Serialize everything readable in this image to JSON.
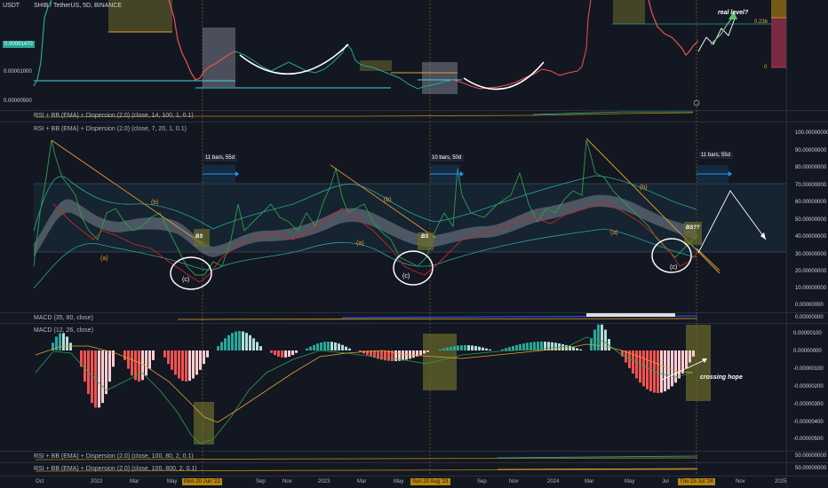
{
  "header": {
    "currency": "USDT",
    "title": "SHIB / TetherUS, 5D, BINANCE",
    "title_color": "#b2b5be"
  },
  "price_pane": {
    "current_price_badge": "0.00001470",
    "badge_color": "#26a69a",
    "y_ticks": [
      "0.00001000",
      "0.00000500"
    ],
    "annotations": {
      "real_level": "real level?",
      "fib_level": "0.236",
      "zero_level": "0"
    }
  },
  "indicators": {
    "rsi_small_top": "RSI + BB (EMA) + Dispersion (2.0) (close, 14, 100, 1, 0.1)",
    "rsi_main": "RSI + BB (EMA) + Dispersion (2.0) (close, 7, 20, 1, 0.1)",
    "macd_small": "MACD (35, 80, close)",
    "macd_main": "MACD (12, 26, close)",
    "rsi_bottom_1": "RSI + BB (EMA) + Dispersion (2.0) (close, 100, 80, 2, 0.1)",
    "rsi_bottom_2": "RSI + BB (EMA) + Dispersion (2.0) (close, 100, 800, 2, 0.1)"
  },
  "rsi_pane": {
    "y_ticks": [
      "100.00000000",
      "90.00000000",
      "80.00000000",
      "70.00000000",
      "60.00000000",
      "50.00000000",
      "40.00000000",
      "30.00000000",
      "20.00000000",
      "10.00000000",
      "0.00000000"
    ],
    "bar_labels": [
      "11 bars, 55d",
      "10 bars, 50d",
      "11 bars, 55d"
    ],
    "waves": {
      "a": "(a)",
      "b": "(b)",
      "c": "(c)"
    },
    "bs_labels": [
      "BS",
      "BS",
      "BS??"
    ]
  },
  "macd_small_pane": {
    "y_tick": "0.00000000"
  },
  "macd_pane": {
    "y_ticks": [
      "0.00000100",
      "0.00000000",
      "-0.00000100",
      "-0.00000200",
      "-0.00000300",
      "-0.00000400",
      "-0.00000500"
    ],
    "annotation": "crossing hope"
  },
  "bottom_panes": {
    "y_tick_1": "50.00000000",
    "y_tick_2": "50.00000000"
  },
  "x_axis": {
    "ticks": [
      "Oct",
      "2022",
      "Mar",
      "May",
      "Sep",
      "Nov",
      "2023",
      "Mar",
      "May",
      "Sep",
      "Nov",
      "2024",
      "Mar",
      "May",
      "Jul",
      "Nov",
      "2025"
    ],
    "highlights": [
      "Mon 20 Jun '22",
      "Sun 20 Aug '23",
      "Thu 25 Jul '24"
    ]
  }
}
